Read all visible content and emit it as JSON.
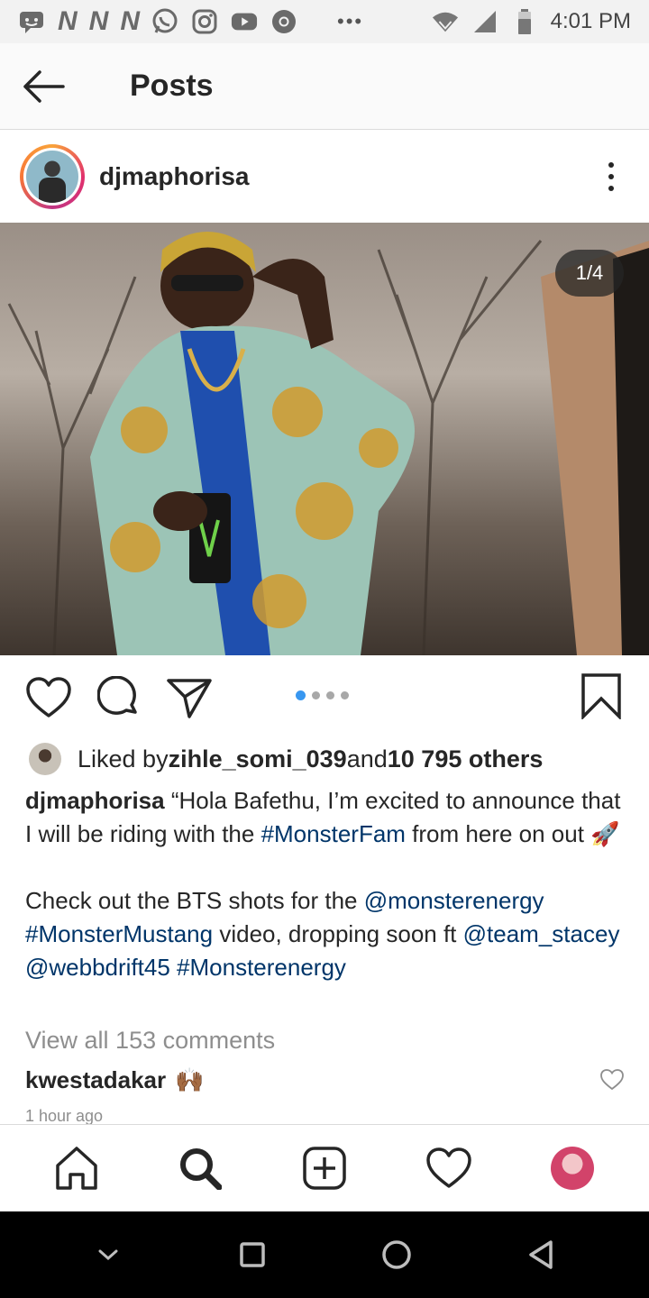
{
  "status_bar": {
    "time": "4:01 PM",
    "left_icons": [
      "messaging-icon",
      "n-icon",
      "n-icon",
      "n-icon",
      "whatsapp-icon",
      "instagram-icon",
      "youtube-icon",
      "chrome-icon"
    ],
    "more": "•••",
    "right_icons": [
      "wifi-icon",
      "signal-icon",
      "battery-icon"
    ],
    "n_letter": "N"
  },
  "header": {
    "title": "Posts",
    "back_icon": "back-arrow-icon"
  },
  "post": {
    "username": "djmaphorisa",
    "photo_counter": "1/4",
    "carousel": {
      "total": 4,
      "active_index": 0
    },
    "likes": {
      "prefix": "Liked by ",
      "user": "zihle_somi_039",
      "middle": " and ",
      "others": "10 795 others"
    },
    "caption": {
      "username": "djmaphorisa",
      "line1_a": " “Hola Bafethu, I’m excited to announce that I will be riding with the ",
      "tag1": "#MonsterFam",
      "line1_b": " from here on out 🚀",
      "line2_a": "Check out the BTS shots for the ",
      "tag2": "@monsterenergy",
      "space1": " ",
      "tag3": "#MonsterMustang",
      "line2_b": " video, dropping soon ft ",
      "tag4": "@team_stacey",
      "space2": " ",
      "tag5": "@webbdrift45",
      "space3": " ",
      "tag6": "#Monsterenergy"
    },
    "view_comments": "View all 153 comments",
    "comment": {
      "user": "kwestadakar",
      "text": "🙌🏾"
    },
    "timestamp": "1 hour ago"
  },
  "colors": {
    "link": "#003569",
    "muted": "#8e8e8e",
    "active_dot": "#3897f0"
  },
  "bottom_nav": [
    "home-icon",
    "search-icon",
    "add-post-icon",
    "activity-heart-icon",
    "profile-avatar"
  ],
  "system_nav": [
    "chevron-down-icon",
    "recents-square-icon",
    "home-circle-icon",
    "back-triangle-icon"
  ]
}
